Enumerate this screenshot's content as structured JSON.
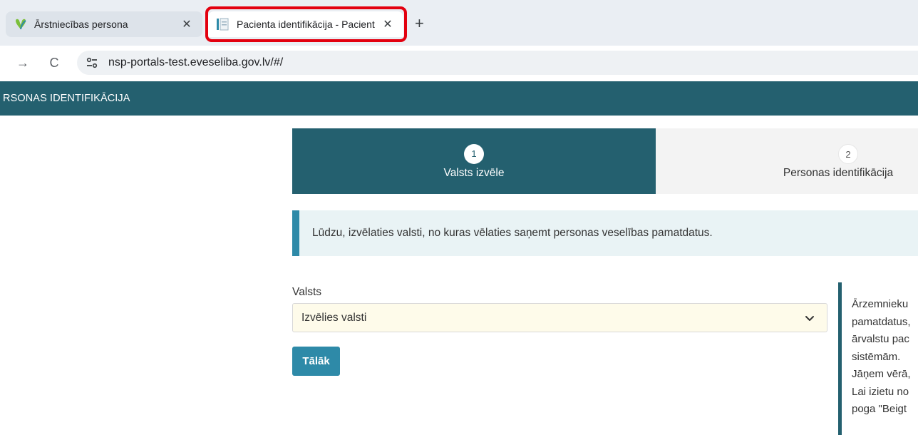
{
  "browser": {
    "tabs": [
      {
        "title": "Ārstniecības persona",
        "active": false
      },
      {
        "title": "Pacienta identifikācija - Pacient",
        "active": true
      }
    ],
    "new_tab_glyph": "+",
    "close_glyph": "✕",
    "back_glyph": "→",
    "reload_glyph": "C",
    "url": "nsp-portals-test.eveseliba.gov.lv/#/",
    "highlight_color": "#e3000f"
  },
  "app": {
    "header_title": "RSONAS IDENTIFIKĀCIJA",
    "brand_color": "#24606f",
    "accent_color": "#2e8aa8"
  },
  "stepper": [
    {
      "number": "1",
      "label": "Valsts izvēle",
      "active": true
    },
    {
      "number": "2",
      "label": "Personas identifikācija",
      "active": false
    }
  ],
  "info_alert": "Lūdzu, izvēlaties valsti, no kuras vēlaties saņemt personas veselības pamatdatus.",
  "form": {
    "country_label": "Valsts",
    "country_select_value": "Izvēlies valsti",
    "next_button": "Tālāk"
  },
  "side_panel": {
    "lines": [
      "Ārzemnieku",
      "pamatdatus,",
      "ārvalstu pac",
      "sistēmām.",
      "Jāņem vērā,",
      "Lai izietu no",
      "poga \"Beigt"
    ]
  },
  "icons": {
    "tab1_favicon": "heart-leaf-icon",
    "tab2_favicon": "document-icon",
    "site_info": "tune-icon",
    "select_caret": "chevron-down-icon"
  }
}
